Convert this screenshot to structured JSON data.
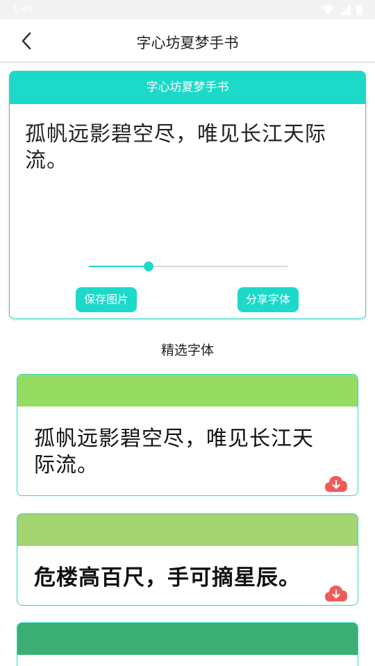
{
  "status_bar": {
    "time": "1:49"
  },
  "app_bar": {
    "title": "字心坊夏梦手书"
  },
  "preview": {
    "header": "字心坊夏梦手书",
    "text": "孤帆远影碧空尽，唯见长江天际流。",
    "font_size_slider": 0.3,
    "save_label": "保存图片",
    "share_label": "分享字体"
  },
  "section_title": "精选字体",
  "fonts": [
    {
      "text": "孤帆远影碧空尽，唯见长江天际流。",
      "header_color": "#96dc63"
    },
    {
      "text": "危楼高百尺，手可摘星辰。",
      "header_color": "#a5d472"
    },
    {
      "text": "",
      "header_color": "#3bae74"
    }
  ],
  "colors": {
    "accent": "#1cd9c8",
    "download": "#ef5b5b"
  },
  "icons": {
    "back": "back-arrow-icon",
    "download": "cloud-download-icon",
    "wifi": "wifi-icon",
    "signal": "signal-icon",
    "battery": "battery-icon"
  }
}
